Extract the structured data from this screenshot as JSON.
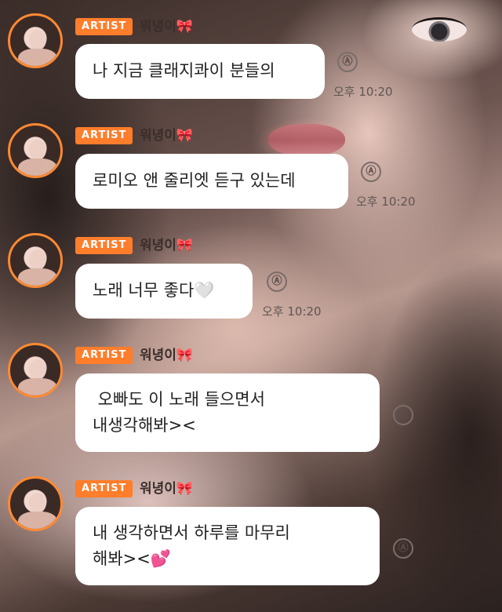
{
  "sender": {
    "badge": "ARTIST",
    "name": "워녕이🎀"
  },
  "reply_icon_glyph": "Ⓐ",
  "messages": [
    {
      "lines": [
        "나 지금 클래지콰이 분들의"
      ],
      "time": "오후 10:20"
    },
    {
      "lines": [
        "로미오 앤 줄리엣 듣구 있는데"
      ],
      "time": "오후 10:20"
    },
    {
      "lines": [
        "노래 너무 좋다🤍"
      ],
      "time": "오후 10:20"
    },
    {
      "lines": [
        " 오빠도 이 노래 들으면서",
        "내생각해봐><"
      ],
      "time": ""
    },
    {
      "lines": [
        "내 생각하면서 하루를 마무리",
        "해봐><💕"
      ],
      "time": ""
    }
  ],
  "colors": {
    "artist_badge": "#ff7d2b",
    "avatar_ring": "#ff8a33",
    "bubble": "#ffffff"
  }
}
